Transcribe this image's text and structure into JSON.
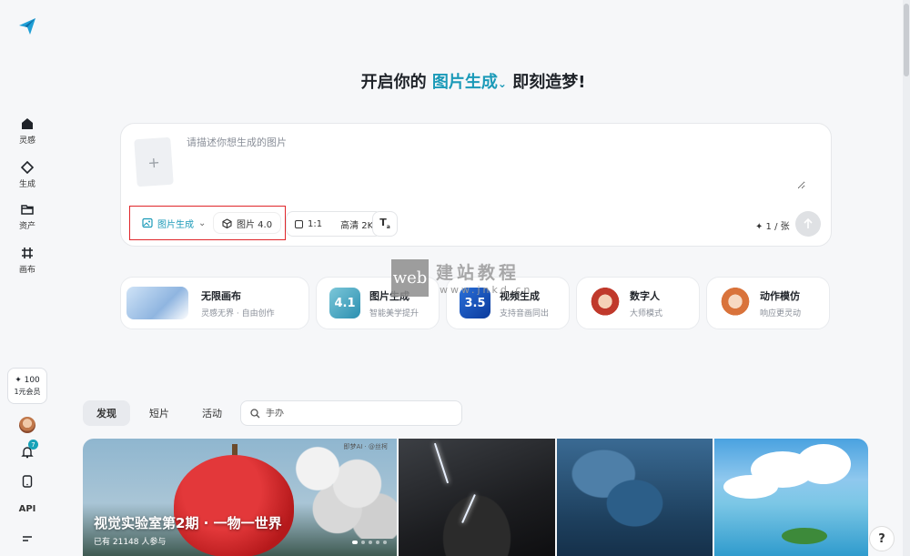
{
  "sidebar": {
    "items": [
      {
        "label": "灵感",
        "icon": "home-icon"
      },
      {
        "label": "生成",
        "icon": "sparkle-icon"
      },
      {
        "label": "资产",
        "icon": "folder-icon"
      },
      {
        "label": "画布",
        "icon": "canvas-icon"
      }
    ],
    "credits": {
      "amount": "✦ 100",
      "label": "1元会员"
    },
    "notification_count": "7",
    "api_label": "API"
  },
  "headline": {
    "prefix": "开启你的",
    "mode": "图片生成",
    "suffix": "即刻造梦!"
  },
  "prompt": {
    "placeholder": "请描述你想生成的图片",
    "mode_chip": "图片生成",
    "model_chip": "图片 4.0",
    "ratio": "1:1",
    "quality": "高清 2K",
    "count": "✦ 1 / 张"
  },
  "features": [
    {
      "title": "无限画布",
      "subtitle": "灵感无界 · 自由创作",
      "thumb": ""
    },
    {
      "title": "图片生成",
      "subtitle": "智能美学提升",
      "thumb": "4.1"
    },
    {
      "title": "视频生成",
      "subtitle": "支持音画同出",
      "thumb": "3.5"
    },
    {
      "title": "数字人",
      "subtitle": "大师模式",
      "thumb": ""
    },
    {
      "title": "动作模仿",
      "subtitle": "响应更灵动",
      "thumb": ""
    }
  ],
  "watermark": {
    "logo": "web",
    "text": "建站教程",
    "url": "www.jnkd.cn"
  },
  "tabs": [
    {
      "label": "发现",
      "active": true
    },
    {
      "label": "短片",
      "active": false
    },
    {
      "label": "活动",
      "active": false
    }
  ],
  "search": {
    "placeholder": "手办"
  },
  "banner": {
    "title": "视觉实验室第2期 · 一物一世界",
    "subtitle": "已有 21148 人参与",
    "tag": "即梦AI · @丝柯"
  },
  "colors": {
    "accent": "#1b9ab8",
    "highlight_frame": "#e0262a"
  }
}
